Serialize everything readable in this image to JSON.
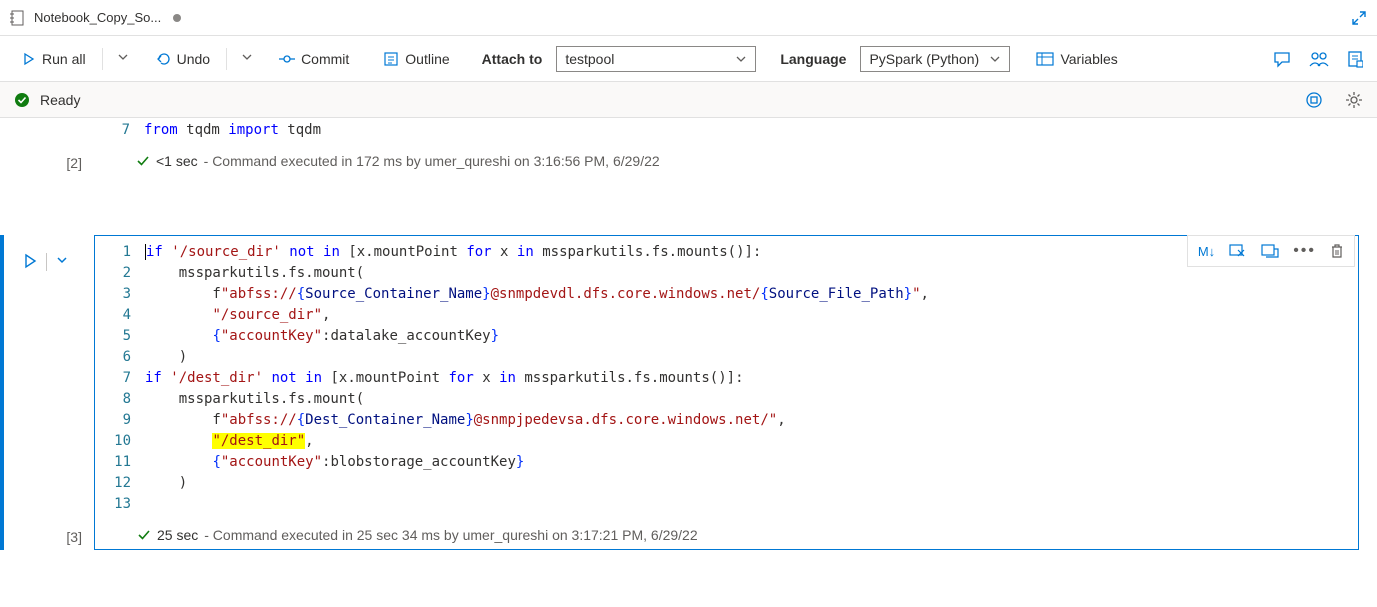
{
  "titleBar": {
    "title": "Notebook_Copy_So..."
  },
  "toolbar": {
    "runAll": "Run all",
    "undo": "Undo",
    "commit": "Commit",
    "outline": "Outline",
    "attachToLabel": "Attach to",
    "attachToValue": "testpool",
    "languageLabel": "Language",
    "languageValue": "PySpark (Python)",
    "variables": "Variables"
  },
  "statusBar": {
    "text": "Ready"
  },
  "cell1": {
    "num": "[2]",
    "lineNum": "7",
    "code": {
      "kw1": "from",
      "mod1": " tqdm ",
      "kw2": "import",
      "mod2": " tqdm"
    },
    "exec": {
      "time": "<1 sec",
      "msg": " - Command executed in 172 ms by umer_qureshi on 3:16:56 PM, 6/29/22"
    }
  },
  "cellToolbar": {
    "md": "M↓"
  },
  "cell2": {
    "num": "[3]",
    "lines": [
      "1",
      "2",
      "3",
      "4",
      "5",
      "6",
      "7",
      "8",
      "9",
      "10",
      "11",
      "12",
      "13"
    ],
    "l1": {
      "kw_if": "if",
      "s1": " '/source_dir'",
      "kw_not": " not",
      "kw_in": " in",
      "t1": " [x.mountPoint ",
      "kw_for": "for",
      "t2": " x ",
      "kw_in2": "in",
      "t3": " mssparkutils.fs.mounts()]:"
    },
    "l2": "    mssparkutils.fs.mount(",
    "l3": {
      "pre": "        f",
      "s1": "\"abfss://",
      "b1": "{",
      "v1": "Source_Container_Name",
      "b2": "}",
      "s2": "@snmpdevdl.dfs.core.windows.net/",
      "b3": "{",
      "v2": "Source_File_Path",
      "b4": "}",
      "s3": "\"",
      "end": ","
    },
    "l4": {
      "pre": "        ",
      "s": "\"/source_dir\"",
      "end": ","
    },
    "l5": {
      "pre": "        ",
      "b1": "{",
      "s": "\"accountKey\"",
      "t": ":datalake_accountKey",
      "b2": "}"
    },
    "l6": "    )",
    "l7": "",
    "l8": {
      "kw_if": "if",
      "s1": " '/dest_dir'",
      "kw_not": " not",
      "kw_in": " in",
      "t1": " [x.mountPoint ",
      "kw_for": "for",
      "t2": " x ",
      "kw_in2": "in",
      "t3": " mssparkutils.fs.mounts()]:"
    },
    "l9": "    mssparkutils.fs.mount(",
    "l10": {
      "pre": "        f",
      "s1": "\"abfss://",
      "b1": "{",
      "v1": "Dest_Container_Name",
      "b2": "}",
      "s2": "@snmpjpedevsa.dfs.core.windows.net/\"",
      "end": ","
    },
    "l11": {
      "pre": "        ",
      "s": "\"/dest_dir\"",
      "end": ","
    },
    "l12": {
      "pre": "        ",
      "b1": "{",
      "s": "\"accountKey\"",
      "t": ":blobstorage_accountKey",
      "b2": "}"
    },
    "l13": "    )",
    "exec": {
      "time": "25 sec",
      "msg": " - Command executed in 25 sec 34 ms by umer_qureshi on 3:17:21 PM, 6/29/22"
    }
  }
}
